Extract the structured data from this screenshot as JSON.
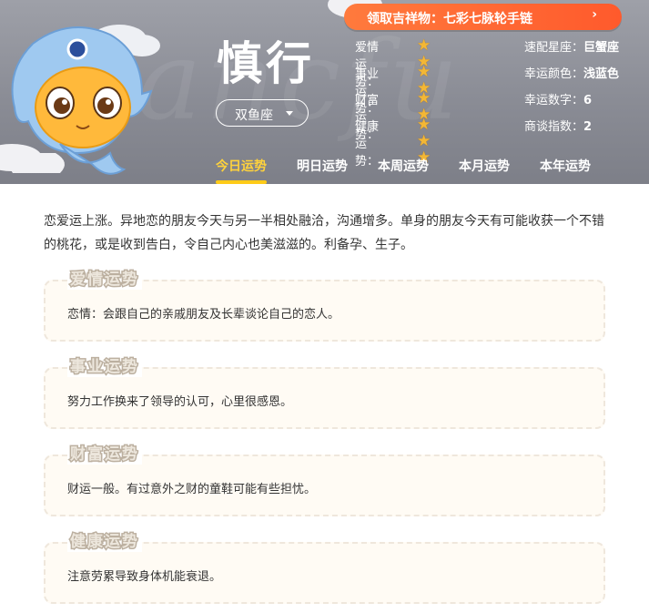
{
  "promo": {
    "label": "领取吉祥物：七彩七脉轮手链",
    "arrow": "›"
  },
  "sign": {
    "name": "慎行",
    "selected": "双鱼座"
  },
  "fortunes": [
    {
      "label": "爱情运势：",
      "stars": 2
    },
    {
      "label": "事业运势：",
      "stars": 2
    },
    {
      "label": "财富运势：",
      "stars": 2
    },
    {
      "label": "健康运势：",
      "stars": 3
    }
  ],
  "info": [
    {
      "label": "速配星座：",
      "value": "巨蟹座"
    },
    {
      "label": "幸运颜色：",
      "value": "浅蓝色"
    },
    {
      "label": "幸运数字：",
      "value": "6"
    },
    {
      "label": "商谈指数：",
      "value": "2"
    }
  ],
  "tabs": [
    "今日运势",
    "明日运势",
    "本周运势",
    "本月运势",
    "本年运势"
  ],
  "active_tab": 0,
  "summary": "恋爱运上涨。异地恋的朋友今天与另一半相处融洽，沟通增多。单身的朋友今天有可能收获一个不错的桃花，或是收到告白，令自己内心也美滋滋的。利备孕、生子。",
  "sections": [
    {
      "title": "爱情运势",
      "text": "恋情：会跟自己的亲戚朋友及长辈谈论自己的恋人。"
    },
    {
      "title": "事业运势",
      "text": "努力工作换来了领导的认可，心里很感恩。"
    },
    {
      "title": "财富运势",
      "text": "财运一般。有过意外之财的童鞋可能有些担忧。"
    },
    {
      "title": "健康运势",
      "text": "注意劳累导致身体机能衰退。"
    }
  ],
  "colors": {
    "header": "#8b8d96",
    "accent": "#ffcb18",
    "promo": "#ff6330",
    "star": "#f3b735"
  }
}
